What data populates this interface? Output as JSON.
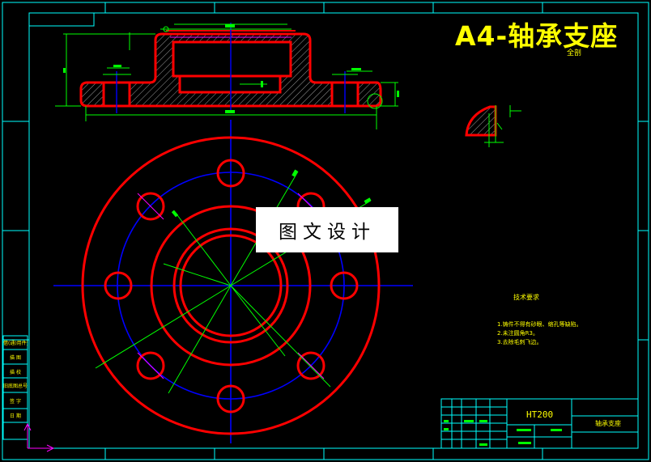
{
  "drawing": {
    "title": "A4-轴承支座",
    "subtitle": "全剖",
    "watermark": "图文设计",
    "material": "HT200",
    "part_name": "轴承支座",
    "notes_title": "技术要求",
    "notes": [
      "1.铸件不得有砂眼、缩孔等缺陷。",
      "2.未注圆角R3。",
      "3.去除毛刺飞边。"
    ],
    "side_labels": [
      "借(通)用件登记",
      "描 图",
      "描 校",
      "旧底图总号",
      "签 字",
      "日 期"
    ]
  },
  "colors": {
    "frame": "#00ffff",
    "outline": "#ff0000",
    "center": "#0000ff",
    "dimension": "#00ff00",
    "hatch": "#ffffff",
    "text": "#ffff00",
    "accent": "#ff00ff"
  }
}
